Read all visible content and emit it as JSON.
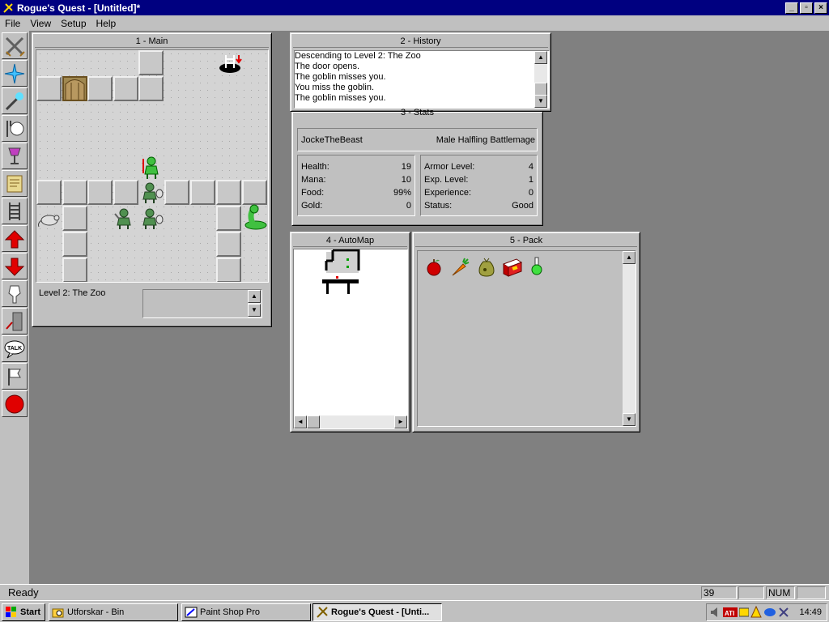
{
  "app": {
    "title": "Rogue's Quest - [Untitled]*"
  },
  "menu": [
    "File",
    "View",
    "Setup",
    "Help"
  ],
  "toolbar": [
    "fight-icon",
    "magic-icon",
    "wand-icon",
    "eat-icon",
    "drink-icon",
    "read-icon",
    "climb-icon",
    "ascend-icon",
    "descend-icon",
    "wear-icon",
    "open-icon",
    "talk-icon",
    "flag-icon",
    "stop-icon"
  ],
  "windows": {
    "main": {
      "title": "1 - Main",
      "level_text": "Level 2: The Zoo"
    },
    "history": {
      "title": "2 - History",
      "lines": [
        "Descending to Level 2: The Zoo",
        "The door opens.",
        "The goblin misses you.",
        "You miss the goblin.",
        "The goblin misses you."
      ]
    },
    "stats": {
      "title": "3 - Stats",
      "name": "JockeTheBeast",
      "race": "Male Halfling Battlemage",
      "left": [
        {
          "label": "Health:",
          "value": "19"
        },
        {
          "label": "Mana:",
          "value": "10"
        },
        {
          "label": "Food:",
          "value": "99%"
        },
        {
          "label": "Gold:",
          "value": "0"
        }
      ],
      "right": [
        {
          "label": "Armor Level:",
          "value": "4"
        },
        {
          "label": "Exp. Level:",
          "value": "1"
        },
        {
          "label": "Experience:",
          "value": "0"
        },
        {
          "label": "Status:",
          "value": "Good"
        }
      ]
    },
    "automap": {
      "title": "4 - AutoMap"
    },
    "pack": {
      "title": "5 - Pack",
      "items": [
        "apple-icon",
        "carrot-icon",
        "sack-icon",
        "book-icon",
        "potion-icon"
      ]
    }
  },
  "statusbar": {
    "text": "Ready",
    "field1": "39",
    "field2": "",
    "field3": "NUM"
  },
  "taskbar": {
    "start": "Start",
    "items": [
      "Utforskar - Bin",
      "Paint Shop Pro",
      "Rogue's Quest - [Unti..."
    ],
    "clock": "14:49"
  }
}
